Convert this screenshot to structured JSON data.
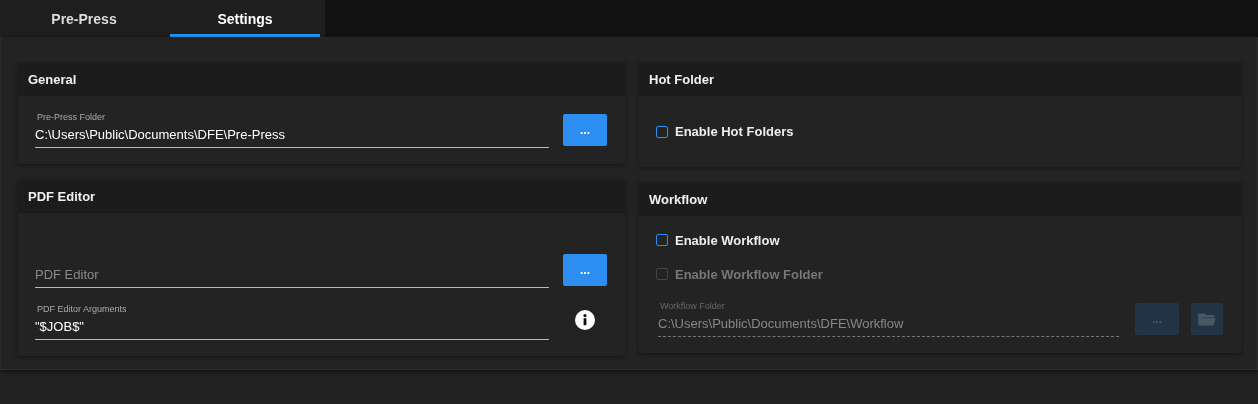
{
  "tabs": [
    {
      "label": "Pre-Press",
      "selected": false
    },
    {
      "label": "Settings",
      "selected": true
    }
  ],
  "general": {
    "title": "General",
    "folder_field": {
      "label": "Pre-Press Folder",
      "value": "C:\\Users\\Public\\Documents\\DFE\\Pre-Press"
    },
    "browse_button": {
      "label": "...",
      "disabled": false
    }
  },
  "pdf_editor": {
    "title": "PDF Editor",
    "editor_field": {
      "placeholder": "PDF Editor"
    },
    "browse_button": {
      "label": "...",
      "disabled": false
    },
    "arguments_field": {
      "label": "PDF Editor Arguments",
      "value": "\"$JOB$\""
    }
  },
  "hot_folder": {
    "title": "Hot Folder",
    "enable_checkbox": {
      "label": "Enable Hot Folders",
      "checked": false,
      "disabled": false
    }
  },
  "workflow": {
    "title": "Workflow",
    "enable_checkbox": {
      "label": "Enable Workflow",
      "checked": false,
      "disabled": false
    },
    "folder_checkbox": {
      "label": "Enable Workflow Folder",
      "checked": false,
      "disabled": true
    },
    "folder_field": {
      "label": "Workflow Folder",
      "value": "C:\\Users\\Public\\Documents\\DFE\\Workflow",
      "disabled": true
    },
    "browse_button": {
      "label": "...",
      "disabled": true
    },
    "open_button": {
      "disabled": true
    }
  }
}
